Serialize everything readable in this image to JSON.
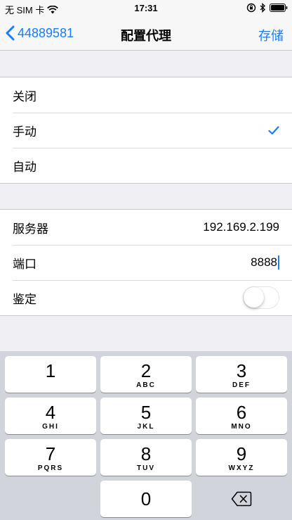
{
  "status": {
    "carrier": "无 SIM 卡",
    "time": "17:31"
  },
  "nav": {
    "back_label": "44889581",
    "title": "配置代理",
    "save_label": "存储"
  },
  "proxy_modes": [
    {
      "label": "关闭",
      "selected": false
    },
    {
      "label": "手动",
      "selected": true
    },
    {
      "label": "自动",
      "selected": false
    }
  ],
  "manual": {
    "server_label": "服务器",
    "server_value": "192.169.2.199",
    "port_label": "端口",
    "port_value": "8888",
    "auth_label": "鉴定",
    "auth_on": false
  },
  "keypad": [
    {
      "num": "1",
      "letters": ""
    },
    {
      "num": "2",
      "letters": "ABC"
    },
    {
      "num": "3",
      "letters": "DEF"
    },
    {
      "num": "4",
      "letters": "GHI"
    },
    {
      "num": "5",
      "letters": "JKL"
    },
    {
      "num": "6",
      "letters": "MNO"
    },
    {
      "num": "7",
      "letters": "PQRS"
    },
    {
      "num": "8",
      "letters": "TUV"
    },
    {
      "num": "9",
      "letters": "WXYZ"
    },
    {
      "num": "0",
      "letters": ""
    }
  ],
  "colors": {
    "accent": "#147efb",
    "background": "#efeff4",
    "keypad_bg": "#d1d4da"
  },
  "icons": {
    "wifi": "wifi-icon",
    "lock": "rotation-lock-icon",
    "bluetooth": "bluetooth-icon",
    "battery": "battery-icon",
    "back": "chevron-left-icon",
    "check": "checkmark-icon",
    "delete": "backspace-icon"
  }
}
